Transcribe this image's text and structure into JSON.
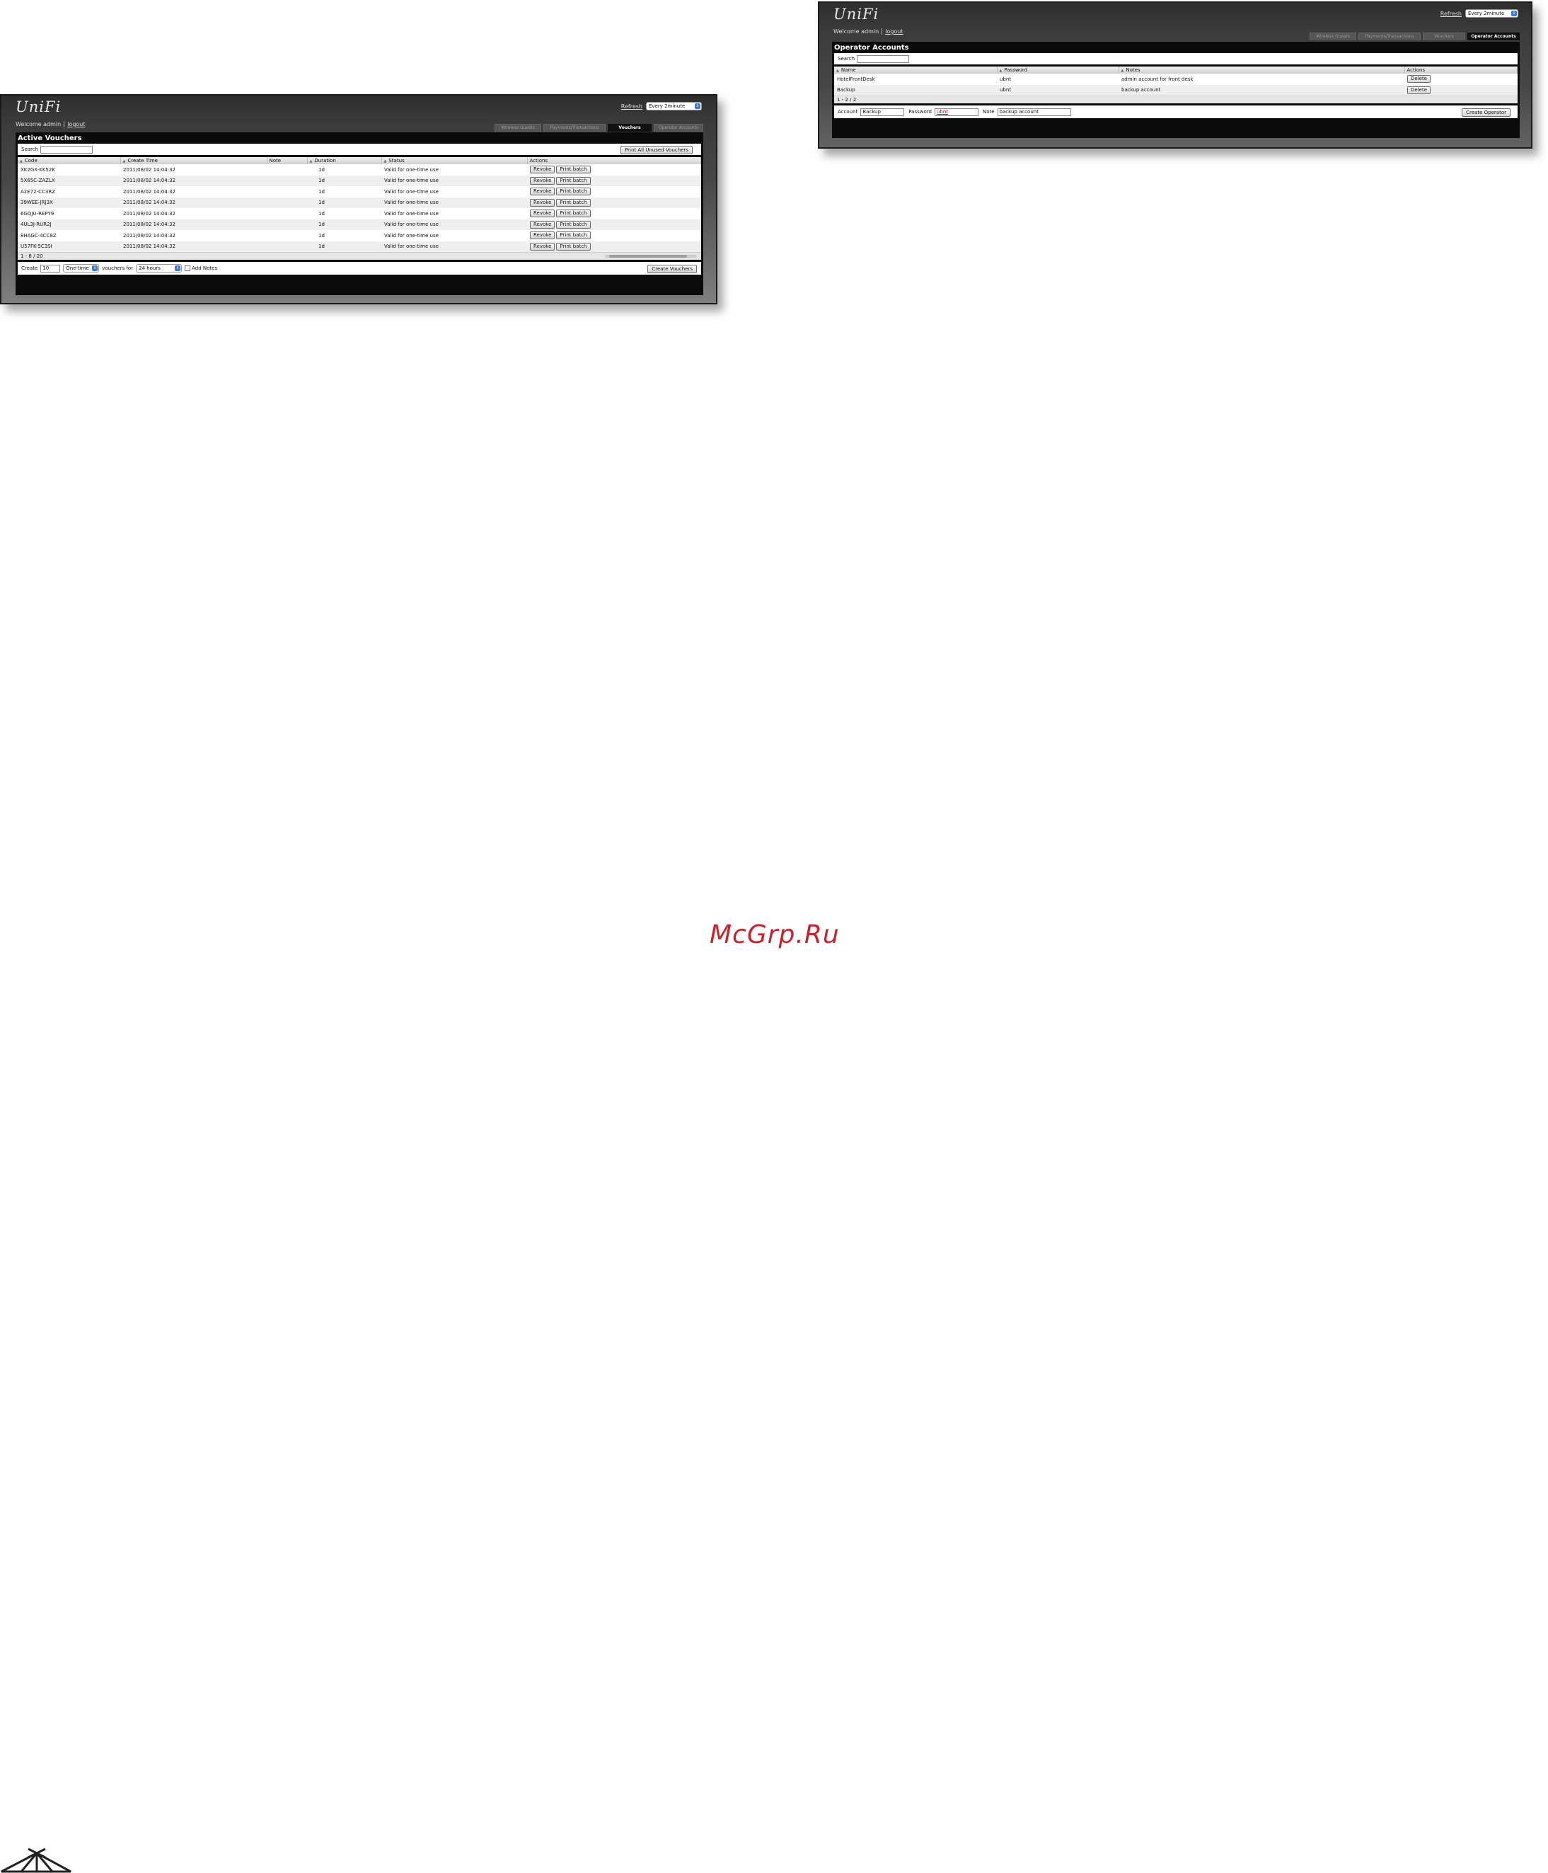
{
  "watermark": "McGrp.Ru",
  "window1": {
    "logo": "UniFi",
    "welcome": "Welcome admin",
    "logout": "logout",
    "refresh_label": "Refresh",
    "refresh_value": "Every 2minute",
    "tabs": [
      "Wireless Guests",
      "Payments/Transactions",
      "Vouchers",
      "Operator Accounts"
    ],
    "panel_title": "Active Vouchers",
    "search_label": "Search",
    "print_all_label": "Print All Unused Vouchers",
    "columns": [
      "Code",
      "Create Time",
      "Note",
      "Duration",
      "Status",
      "Actions"
    ],
    "rows": [
      {
        "code": "XK2GX-KK52K",
        "time": "2011/08/02 14:04:32",
        "note": "",
        "duration": "1d",
        "status": "Valid for one-time use"
      },
      {
        "code": "5X65C-ZAZLX",
        "time": "2011/08/02 14:04:32",
        "note": "",
        "duration": "1d",
        "status": "Valid for one-time use"
      },
      {
        "code": "A2E72-CC3RZ",
        "time": "2011/08/02 14:04:32",
        "note": "",
        "duration": "1d",
        "status": "Valid for one-time use"
      },
      {
        "code": "39WEE-JRJ3X",
        "time": "2011/08/02 14:04:32",
        "note": "",
        "duration": "1d",
        "status": "Valid for one-time use"
      },
      {
        "code": "6GQJU-REPY9",
        "time": "2011/08/02 14:04:32",
        "note": "",
        "duration": "1d",
        "status": "Valid for one-time use"
      },
      {
        "code": "4UL3J-RUR2J",
        "time": "2011/08/02 14:04:32",
        "note": "",
        "duration": "1d",
        "status": "Valid for one-time use"
      },
      {
        "code": "8HAGC-4CC8Z",
        "time": "2011/08/02 14:04:32",
        "note": "",
        "duration": "1d",
        "status": "Valid for one-time use"
      },
      {
        "code": "U57FK-5C3SI",
        "time": "2011/08/02 14:04:32",
        "note": "",
        "duration": "1d",
        "status": "Valid for one-time use"
      }
    ],
    "revoke_label": "Revoke",
    "print_batch_label": "Print batch",
    "pager": "1 - 8 / 20",
    "create_label": "Create",
    "create_count": "10",
    "type_value": "One-time",
    "vouchers_for": "vouchers for",
    "duration_value": "24 hours",
    "add_notes": "Add Notes",
    "create_button": "Create Vouchers"
  },
  "window2": {
    "logo": "UniFi",
    "welcome": "Welcome admin",
    "logout": "logout",
    "refresh_label": "Refresh",
    "refresh_value": "Every 2minute",
    "tabs": [
      "Wireless Guests",
      "Payments/Transactions",
      "Vouchers",
      "Operator Accounts"
    ],
    "panel_title": "Operator Accounts",
    "search_label": "Search",
    "columns": [
      "Name",
      "Password",
      "Notes",
      "Actions"
    ],
    "rows": [
      {
        "name": "HotelFrontDesk",
        "password": "ubnt",
        "notes": "admin account for front desk"
      },
      {
        "name": "Backup",
        "password": "ubnt",
        "notes": "backup account"
      }
    ],
    "delete_label": "Delete",
    "pager": "1 - 2 / 2",
    "account_label": "Account",
    "account_value": "Backup",
    "password_label": "Password",
    "password_value": "ubnt",
    "note_label": "Note",
    "note_value": "backup account",
    "create_button": "Create Operator"
  }
}
